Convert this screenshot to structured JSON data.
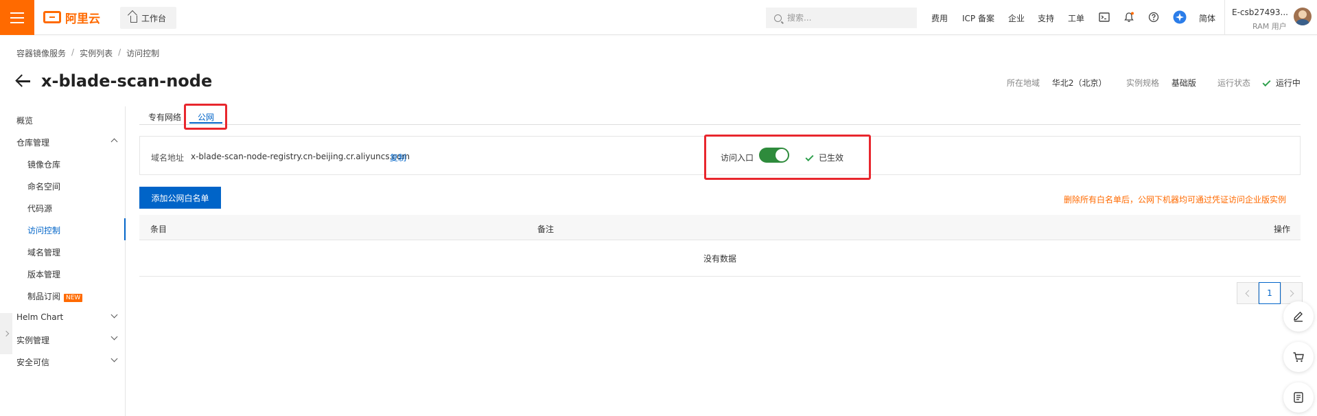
{
  "topbar": {
    "brand": "阿里云",
    "workbench": "工作台",
    "search_placeholder": "搜索...",
    "nav": [
      "费用",
      "ICP 备案",
      "企业",
      "支持",
      "工单"
    ],
    "lang": "简体",
    "user_name": "E-csb27493...",
    "user_role": "RAM 用户",
    "accent_color": "#ff6a00"
  },
  "breadcrumb": [
    "容器镜像服务",
    "实例列表",
    "访问控制"
  ],
  "page": {
    "title": "x-blade-scan-node",
    "region_label": "所在地域",
    "region_value": "华北2（北京）",
    "spec_label": "实例规格",
    "spec_value": "基础版",
    "status_label": "运行状态",
    "status_value": "运行中"
  },
  "sidebar": {
    "items": [
      {
        "label": "概览"
      },
      {
        "label": "仓库管理"
      },
      {
        "label": "镜像仓库"
      },
      {
        "label": "命名空间"
      },
      {
        "label": "代码源"
      },
      {
        "label": "访问控制"
      },
      {
        "label": "域名管理"
      },
      {
        "label": "版本管理"
      },
      {
        "label": "制品订阅"
      },
      {
        "label": "Helm Chart"
      },
      {
        "label": "实例管理"
      },
      {
        "label": "安全可信"
      }
    ],
    "new_badge": "NEW"
  },
  "tabs": [
    "专有网络",
    "公网"
  ],
  "domain": {
    "label": "域名地址",
    "value": "x-blade-scan-node-registry.cn-beijing.cr.aliyuncs.com",
    "copy": "复制",
    "access_label": "访问入口",
    "access_enabled": true,
    "effective": "已生效"
  },
  "actions": {
    "add_whitelist": "添加公网白名单",
    "warning": "删除所有白名单后，公网下机器均可通过凭证访问企业版实例"
  },
  "table": {
    "columns": [
      "条目",
      "备注",
      "操作"
    ],
    "empty": "没有数据"
  },
  "pagination": {
    "current": "1"
  }
}
